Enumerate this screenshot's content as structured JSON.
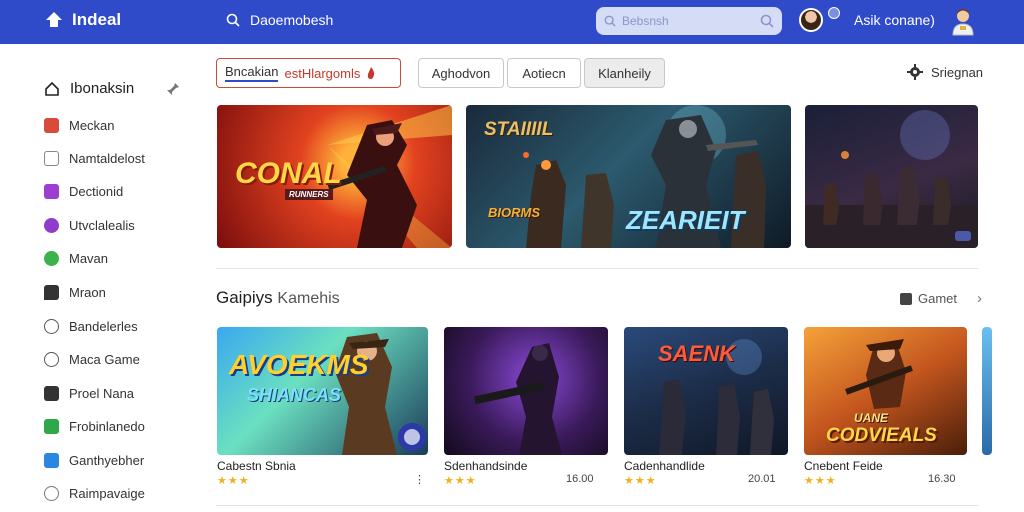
{
  "header": {
    "app_name": "Indeal",
    "search_label": "Daoemobesh",
    "search_placeholder": "Bebsnsh",
    "account_label": "Asik conane)"
  },
  "sidebar": {
    "title": "Ibonaksin",
    "items": [
      {
        "label": "Meckan",
        "icon": "red-square-icon",
        "color": "#d84a3a"
      },
      {
        "label": "Namtaldelost",
        "icon": "image-icon",
        "color": "#888888"
      },
      {
        "label": "Dectionid",
        "icon": "purple-square-icon",
        "color": "#9c3fd1"
      },
      {
        "label": "Utvclalealis",
        "icon": "purple-circle-icon",
        "color": "#8e3ec9"
      },
      {
        "label": "Mavan",
        "icon": "green-circle-icon",
        "color": "#3bb34a"
      },
      {
        "label": "Mraon",
        "icon": "message-icon",
        "color": "#333333"
      },
      {
        "label": "Bandelerles",
        "icon": "plus-circle-icon",
        "color": "#555555"
      },
      {
        "label": "Maca Game",
        "icon": "help-circle-icon",
        "color": "#555555"
      },
      {
        "label": "Proel Nana",
        "icon": "check-square-icon",
        "color": "#333333"
      },
      {
        "label": "Frobinlanedo",
        "icon": "green-check-icon",
        "color": "#2fa84a"
      },
      {
        "label": "Ganthyebher",
        "icon": "blue-check-icon",
        "color": "#2a86e0"
      },
      {
        "label": "Raimpavaige",
        "icon": "info-circle-icon",
        "color": "#777777"
      }
    ]
  },
  "filters": {
    "search_tab": "Bncakian",
    "search_hint": "estHlargomls",
    "chips": [
      "Aghodvon",
      "Aotiecn",
      "Klanheily"
    ],
    "settings_label": "Sriegnan"
  },
  "heroes": [
    {
      "art_text": "CONAL",
      "art_sub": "RUNNERS"
    },
    {
      "art_text": "STAIIIIL",
      "art_sub": "ZEARIEIT",
      "art_tag": "BIORMS"
    },
    {
      "art_text": ""
    }
  ],
  "section": {
    "title": "Gaipiys",
    "subtitle": "Kamehis",
    "more_label": "Gamet"
  },
  "cards": [
    {
      "title": "Cabestn Sbnia",
      "art_text": "AVOEKMS",
      "art_sub": "SHIANCAS",
      "rating": 3,
      "meta": ""
    },
    {
      "title": "Sdenhandsinde",
      "art_text": "",
      "rating": 3,
      "meta": "16.00"
    },
    {
      "title": "Cadenhandlide",
      "art_text": "SAENK",
      "rating": 3,
      "meta": "20.01"
    },
    {
      "title": "Cnebent Feide",
      "art_text": "UANE",
      "art_sub": "CODVIEALS",
      "rating": 3,
      "meta": "16.30"
    }
  ],
  "colors": {
    "topbar": "#2f4bc9",
    "accent_red": "#c7392b",
    "star": "#f2b01e"
  }
}
